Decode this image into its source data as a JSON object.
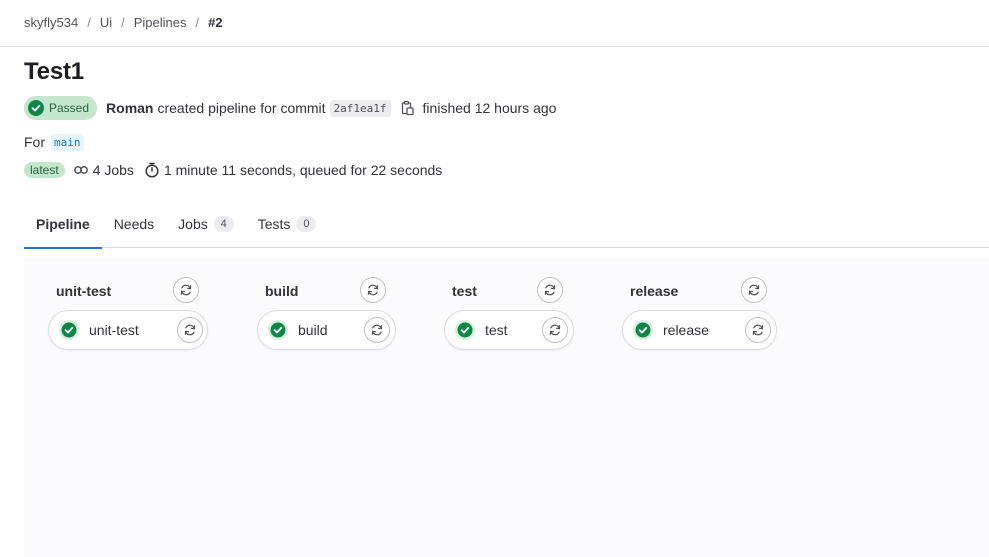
{
  "breadcrumb": {
    "items": [
      "skyfly534",
      "Ui",
      "Pipelines"
    ],
    "current": "#2",
    "separator": "/"
  },
  "pipeline": {
    "title": "Test1",
    "status": "Passed",
    "author": "Roman",
    "created_text": "created pipeline for commit",
    "commit_sha": "2af1ea1f",
    "finished_text": "finished 12 hours ago",
    "for_label": "For",
    "ref": "main",
    "latest_badge": "latest",
    "jobs_count_text": "4 Jobs",
    "duration_text": "1 minute 11 seconds, queued for 22 seconds"
  },
  "tabs": [
    {
      "label": "Pipeline",
      "active": true
    },
    {
      "label": "Needs"
    },
    {
      "label": "Jobs",
      "count": "4"
    },
    {
      "label": "Tests",
      "count": "0"
    }
  ],
  "stages": [
    {
      "name": "unit-test",
      "job": "unit-test",
      "status": "success"
    },
    {
      "name": "build",
      "job": "build",
      "status": "success"
    },
    {
      "name": "test",
      "job": "test",
      "status": "success"
    },
    {
      "name": "release",
      "job": "release",
      "status": "success"
    }
  ],
  "colors": {
    "success": "#108548",
    "success_bg": "#c3e6cd",
    "accent": "#1f75cb"
  },
  "icons": {
    "status": "status-success-icon",
    "copy": "copy-to-clipboard-icon",
    "jobs": "pipeline-jobs-icon",
    "clock": "timer-icon",
    "retry": "retry-icon"
  }
}
